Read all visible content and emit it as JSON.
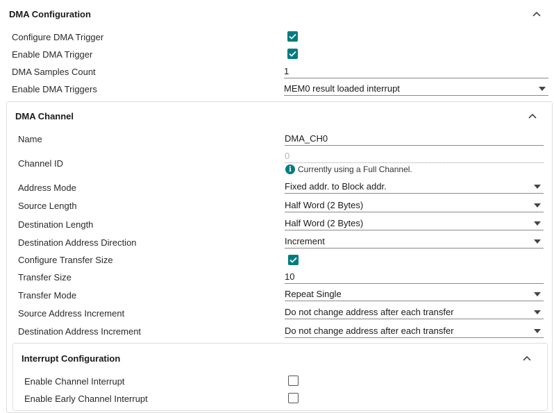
{
  "dma_config": {
    "title": "DMA Configuration",
    "configure_trigger": {
      "label": "Configure DMA Trigger",
      "checked": true
    },
    "enable_trigger": {
      "label": "Enable DMA Trigger",
      "checked": true
    },
    "samples_count": {
      "label": "DMA Samples Count",
      "value": "1"
    },
    "enable_triggers": {
      "label": "Enable DMA Triggers",
      "value": "MEM0 result loaded interrupt"
    }
  },
  "dma_channel": {
    "title": "DMA Channel",
    "name": {
      "label": "Name",
      "value": "DMA_CH0"
    },
    "channel_id": {
      "label": "Channel ID",
      "value": "0",
      "info": "Currently using a Full Channel."
    },
    "address_mode": {
      "label": "Address Mode",
      "value": "Fixed addr. to Block addr."
    },
    "source_length": {
      "label": "Source Length",
      "value": "Half Word (2 Bytes)"
    },
    "destination_length": {
      "label": "Destination Length",
      "value": "Half Word (2 Bytes)"
    },
    "destination_address_direction": {
      "label": "Destination Address Direction",
      "value": "Increment"
    },
    "configure_transfer_size": {
      "label": "Configure Transfer Size",
      "checked": true
    },
    "transfer_size": {
      "label": "Transfer Size",
      "value": "10"
    },
    "transfer_mode": {
      "label": "Transfer Mode",
      "value": "Repeat Single"
    },
    "source_address_increment": {
      "label": "Source Address Increment",
      "value": "Do not change address after each transfer"
    },
    "destination_address_increment": {
      "label": "Destination Address Increment",
      "value": "Do not change address after each transfer"
    }
  },
  "interrupt_config": {
    "title": "Interrupt Configuration",
    "enable_channel_interrupt": {
      "label": "Enable Channel Interrupt",
      "checked": false
    },
    "enable_early_channel_interrupt": {
      "label": "Enable Early Channel Interrupt",
      "checked": false
    }
  },
  "colors": {
    "accent": "#007c80",
    "border": "#dedede",
    "underline": "#8a8a8a"
  },
  "icons": {
    "collapse": "chevron-up-icon",
    "dropdown": "caret-down-icon",
    "check": "check-icon",
    "info": "info-icon"
  }
}
